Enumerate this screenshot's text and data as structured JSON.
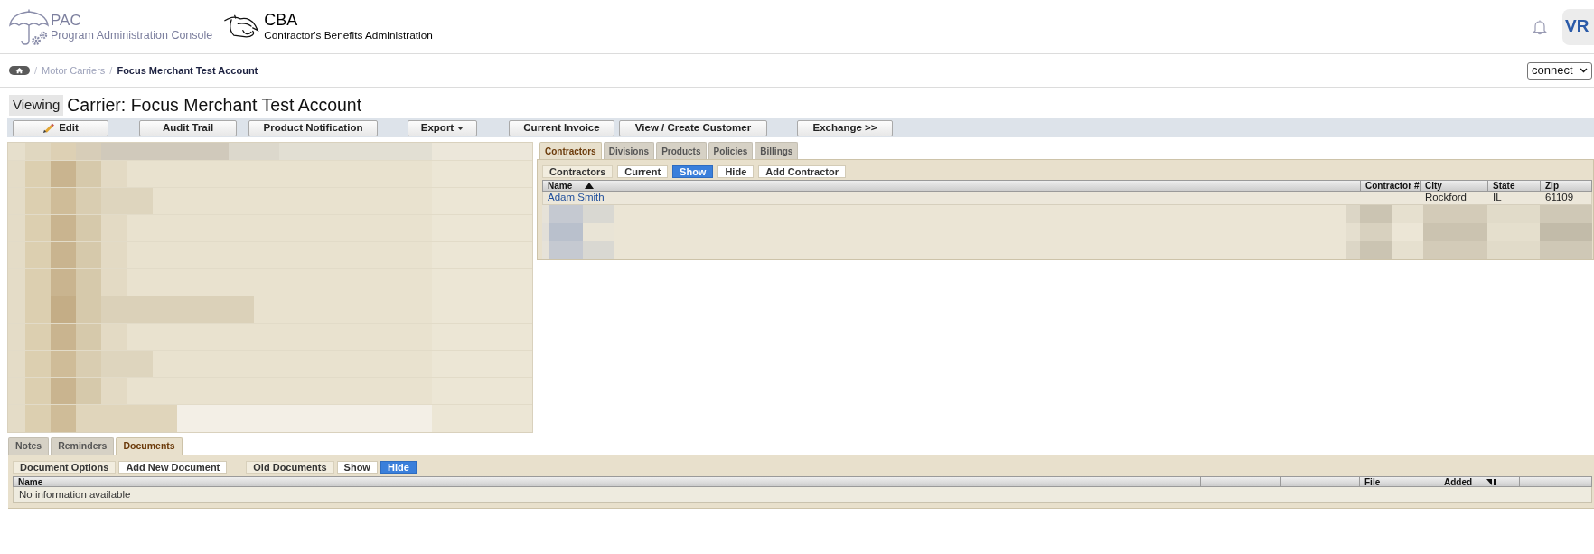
{
  "header": {
    "app": {
      "title": "PAC",
      "subtitle": "Program Administration Console"
    },
    "module": {
      "title": "CBA",
      "subtitle": "Contractor's Benefits Administration"
    },
    "user": {
      "initials": "VR"
    }
  },
  "breadcrumb": {
    "separator": "/",
    "items": [
      {
        "label": "Motor Carriers",
        "current": false
      },
      {
        "label": "Focus Merchant Test Account",
        "current": true
      }
    ]
  },
  "context_select": {
    "value": "connect"
  },
  "page_heading": {
    "badge": "Viewing",
    "title": "Carrier: Focus Merchant Test Account"
  },
  "toolbar": [
    {
      "label": "Edit",
      "icon": true,
      "dropdown": false
    },
    {
      "label": "Audit Trail",
      "icon": false,
      "dropdown": false
    },
    {
      "label": "Product Notification",
      "icon": false,
      "dropdown": false
    },
    {
      "label": "Export",
      "icon": false,
      "dropdown": true
    },
    {
      "label": "Current Invoice",
      "icon": false,
      "dropdown": false
    },
    {
      "label": "View / Create Customer",
      "icon": false,
      "dropdown": false
    },
    {
      "label": "Exchange >>",
      "icon": false,
      "dropdown": false
    }
  ],
  "contractors_section": {
    "tabs": [
      {
        "label": "Contractors",
        "selected": true
      },
      {
        "label": "Divisions",
        "selected": false
      },
      {
        "label": "Products",
        "selected": false
      },
      {
        "label": "Policies",
        "selected": false
      },
      {
        "label": "Billings",
        "selected": false
      }
    ],
    "toolbar": [
      {
        "kind": "label",
        "text": "Contractors"
      },
      {
        "kind": "button",
        "text": "Current"
      },
      {
        "kind": "toggle",
        "options": [
          {
            "text": "Show",
            "selected": true
          },
          {
            "text": "Hide",
            "selected": false
          }
        ]
      },
      {
        "kind": "button",
        "text": "Add Contractor"
      }
    ],
    "table": {
      "columns": [
        {
          "label": "Name",
          "sort_indicator": {
            "descending": false
          }
        },
        {
          "label": "Contractor #"
        },
        {
          "label": "City"
        },
        {
          "label": "State"
        },
        {
          "label": "Zip"
        }
      ],
      "rows": [
        {
          "name": "Adam Smith",
          "city": "Rockford",
          "state": "IL",
          "zip": "61109"
        }
      ]
    }
  },
  "documents_section": {
    "tabs": [
      {
        "label": "Notes",
        "selected": false
      },
      {
        "label": "Reminders",
        "selected": false
      },
      {
        "label": "Documents",
        "selected": true
      }
    ],
    "toolbar": [
      {
        "kind": "label",
        "text": "Document Options"
      },
      {
        "kind": "button",
        "text": "Add New Document"
      },
      {
        "kind": "label",
        "text": "Old Documents"
      },
      {
        "kind": "toggle",
        "options": [
          {
            "text": "Show",
            "selected": false
          },
          {
            "text": "Hide",
            "selected": true
          }
        ]
      }
    ],
    "table": {
      "columns": [
        {
          "label": "Name"
        },
        {},
        {},
        {
          "label": "File"
        },
        {
          "label": "Added",
          "sort_indicator": {
            "descending": true
          }
        },
        {}
      ],
      "empty_message": "No information available"
    }
  }
}
